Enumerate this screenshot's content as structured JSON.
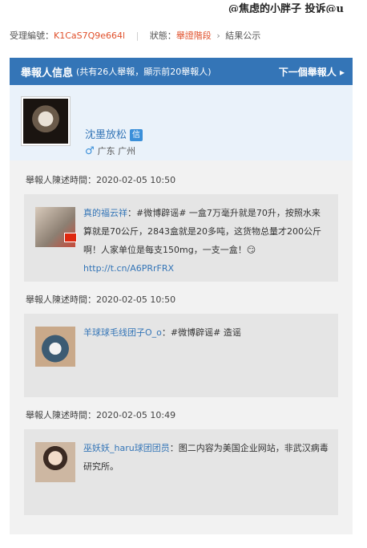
{
  "header": {
    "title": "@焦虑的小胖子 投诉@u"
  },
  "case": {
    "id_label": "受理編號：",
    "id_value": "K1CaS7Q9e664l",
    "status_label": "狀態：",
    "status_value": "舉證階段",
    "next_step": "結果公示"
  },
  "panel": {
    "title": "舉報人信息",
    "subtitle": "(共有26人舉報，顯示前20舉報人)",
    "next_button": "下一個舉報人"
  },
  "reporter": {
    "name": "沈墨放松",
    "badge": "信",
    "location": "广东 广州"
  },
  "records": [
    {
      "time": "舉報人陳述時間：2020-02-05 10:50",
      "user": "真的福云祥",
      "text": "：#微博辟谣# 一盒7万毫升就是70升，按照水来算就是70公斤，2843盒就是20多吨，这货物总量才200公斤啊！人家单位是每支150mg，一支一盒！😏",
      "link": "http://t.cn/A6PRrFRX"
    },
    {
      "time": "舉報人陳述時間：2020-02-05 10:50",
      "user": "羊球球毛线团子O_o",
      "text": "：#微博辟谣# 造谣",
      "link": ""
    },
    {
      "time": "舉報人陳述時間：2020-02-05 10:49",
      "user": "巫妖妖_haru球团团员",
      "text": "：图二内容为美国企业网站，非武汉病毒研究所。",
      "link": ""
    }
  ]
}
